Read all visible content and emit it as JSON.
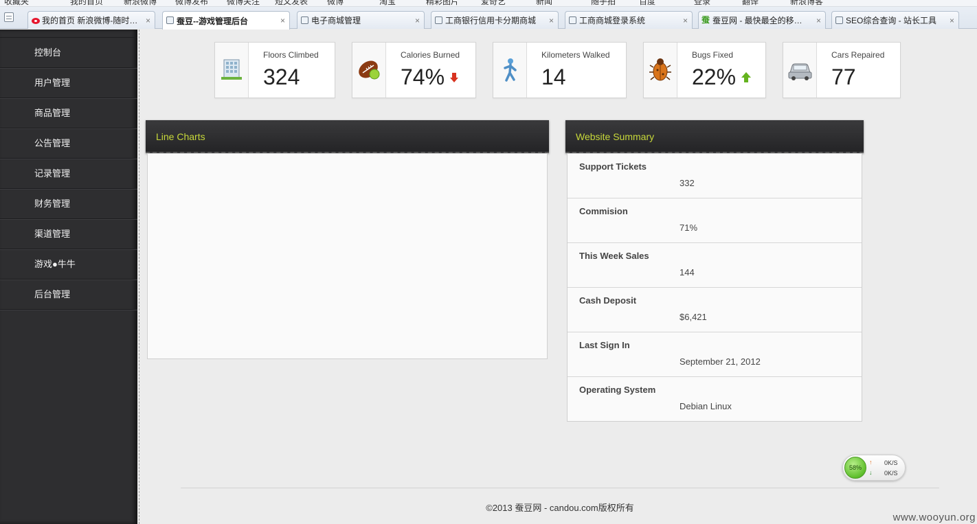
{
  "browser": {
    "bookmarks": [
      "收藏夹",
      "我的首页",
      "新浪微博",
      "微博发布",
      "微博关注",
      "短文发表",
      "微博",
      "淘宝",
      "精彩图片",
      "爱奇艺",
      "新闻",
      "随手拍",
      "百度",
      "登录",
      "翻译",
      "新浪博客"
    ],
    "tabs": [
      {
        "label": "我的首页 新浪微博-随时…",
        "icon": "weibo-icon",
        "active": false
      },
      {
        "label": "蚕豆--游戏管理后台",
        "icon": "page-icon",
        "active": true
      },
      {
        "label": "电子商城管理",
        "icon": "page-icon",
        "active": false
      },
      {
        "label": "工商银行信用卡分期商城",
        "icon": "page-icon",
        "active": false
      },
      {
        "label": "工商商城登录系统",
        "icon": "page-icon",
        "active": false
      },
      {
        "label": "蚕豆网 - 最快最全的移…",
        "icon": "candou-icon",
        "active": false
      },
      {
        "label": "SEO综合查询 - 站长工具",
        "icon": "page-icon",
        "active": false
      }
    ],
    "close_glyph": "×",
    "candou_glyph": "蚕"
  },
  "sidebar": {
    "items": [
      "控制台",
      "用户管理",
      "商品管理",
      "公告管理",
      "记录管理",
      "财务管理",
      "渠道管理",
      "游戏●牛牛",
      "后台管理"
    ]
  },
  "stats": [
    {
      "label": "Floors Climbed",
      "value": "324",
      "icon": "building-icon",
      "trend": ""
    },
    {
      "label": "Calories Burned",
      "value": "74%",
      "icon": "football-icon",
      "trend": "down"
    },
    {
      "label": "Kilometers Walked",
      "value": "14",
      "icon": "walker-icon",
      "trend": ""
    },
    {
      "label": "Bugs Fixed",
      "value": "22%",
      "icon": "bug-icon",
      "trend": "up"
    },
    {
      "label": "Cars Repaired",
      "value": "77",
      "icon": "car-icon",
      "trend": ""
    }
  ],
  "line_charts": {
    "title": "Line Charts"
  },
  "summary": {
    "title": "Website Summary",
    "rows": [
      {
        "label": "Support Tickets",
        "value": "332"
      },
      {
        "label": "Commision",
        "value": "71%"
      },
      {
        "label": "This Week Sales",
        "value": "144"
      },
      {
        "label": "Cash Deposit",
        "value": "$6,421"
      },
      {
        "label": "Last Sign In",
        "value": "September 21, 2012"
      },
      {
        "label": "Operating System",
        "value": "Debian Linux"
      }
    ]
  },
  "net_widget": {
    "percent": "58%",
    "up_glyph": "↑",
    "down_glyph": "↓",
    "up_rate": "0K/S",
    "down_rate": "0K/S"
  },
  "footer": {
    "copyright": "©2013 蚕豆网 - candou.com版权所有"
  },
  "watermark": "www.wooyun.org",
  "colors": {
    "accent_title": "#c8d93a",
    "sidebar_bg": "#2e2e30",
    "trend_down": "#d8321f",
    "trend_up": "#64b31e"
  }
}
